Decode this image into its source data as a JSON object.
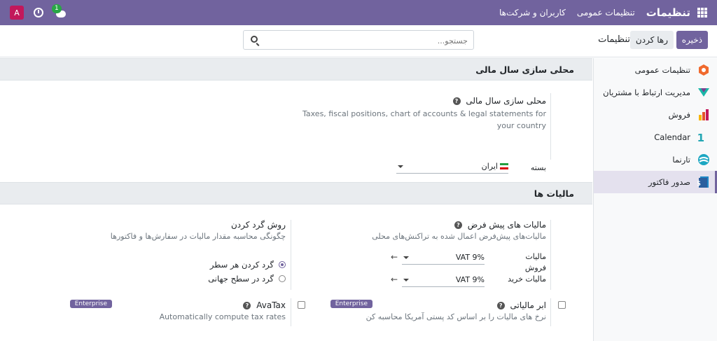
{
  "topbar": {
    "brand": "تنظیمات",
    "menu": [
      "تنظیمات عمومی",
      "کاربران و شرکت‌ها"
    ],
    "avatar_letter": "A",
    "chat_badge": "1",
    "bg_color": "#71639e"
  },
  "control": {
    "save_label": "ذخیره",
    "discard_label": "رها کردن",
    "title": "تنظیمات",
    "search_placeholder": "جستجو..."
  },
  "sidebar": {
    "items": [
      {
        "label": "تنظیمات عمومی",
        "icon": "general-settings-icon",
        "active": false
      },
      {
        "label": "مدیریت ارتباط با مشتریان",
        "icon": "crm-icon",
        "active": false
      },
      {
        "label": "فروش",
        "icon": "sales-icon",
        "active": false
      },
      {
        "label": "Calendar",
        "icon": "calendar-icon",
        "active": false
      },
      {
        "label": "تارنما",
        "icon": "website-icon",
        "active": false
      },
      {
        "label": "صدور فاکتور",
        "icon": "invoicing-icon",
        "active": true
      }
    ]
  },
  "fiscal": {
    "section_title": "محلی سازی سال مالی",
    "setting_title": "محلی سازی سال مالی",
    "description_line1": "Taxes, fiscal positions, chart of accounts & legal statements for",
    "description_line2": "your country",
    "package_label": "بسته",
    "package_value": "ایران"
  },
  "taxes": {
    "section_title": "مالیات ها",
    "default_taxes": {
      "title": "مالیات های پیش فرض",
      "description": "مالیات‌های پیش‌فرض اعمال شده به تراکنش‌های محلی",
      "sales_label_1": "مالیات",
      "sales_label_2": "فروش",
      "sales_value": "VAT 9%",
      "purchase_label": "مالیات خرید",
      "purchase_value": "VAT 9%"
    },
    "rounding": {
      "title": "روش گرد کردن",
      "description": "چگونگی محاسبه مقدار مالیات در سفارش‌ها و فاکتورها",
      "options": [
        "گرد کردن هر سطر",
        "گرد در سطح جهانی"
      ],
      "selected_index": 0
    },
    "cloud_tax": {
      "title": "ابر مالیاتی",
      "description": "نرخ های مالیات را بر اساس کد پستی آمریکا محاسبه کن",
      "badge": "Enterprise",
      "checked": false
    },
    "avatax": {
      "title": "AvaTax",
      "description": "Automatically compute tax rates",
      "badge": "Enterprise",
      "checked": false
    }
  }
}
